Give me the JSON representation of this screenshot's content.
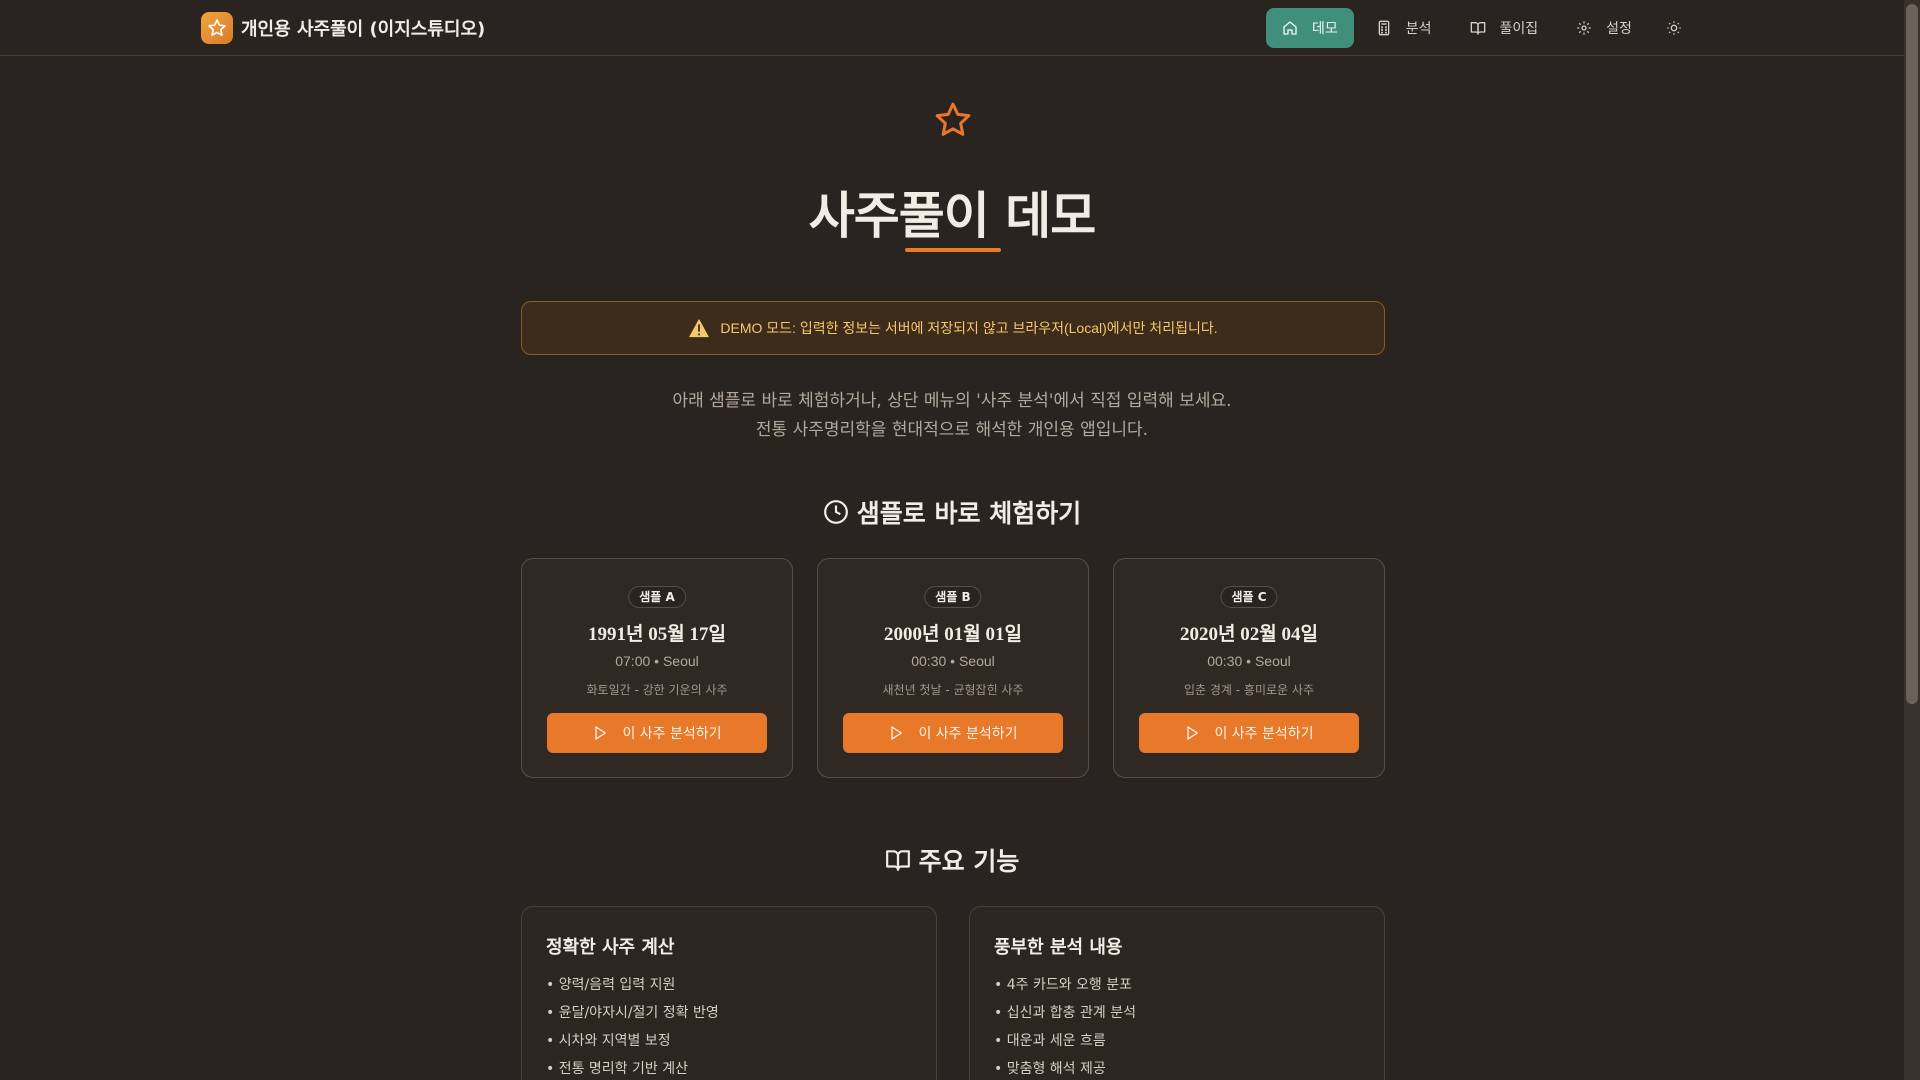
{
  "header": {
    "title": "개인용 사주풀이 (이지스튜디오)",
    "nav": [
      {
        "label": "데모",
        "icon": "home-icon",
        "active": true
      },
      {
        "label": "분석",
        "icon": "calculator-icon",
        "active": false
      },
      {
        "label": "풀이집",
        "icon": "book-icon",
        "active": false
      },
      {
        "label": "설정",
        "icon": "gear-icon",
        "active": false
      }
    ],
    "theme_icon": "sun-icon"
  },
  "hero": {
    "title": "사주풀이 데모",
    "banner": "DEMO 모드: 입력한 정보는 서버에 저장되지 않고 브라우저(Local)에서만 처리됩니다.",
    "intro_line1": "아래 샘플로 바로 체험하거나, 상단 메뉴의 '사주 분석'에서 직접 입력해 보세요.",
    "intro_line2": "전통 사주명리학을 현대적으로 해석한 개인용 앱입니다."
  },
  "samples": {
    "title": "샘플로 바로 체험하기",
    "cards": [
      {
        "badge": "샘플 A",
        "date": "1991년 05월 17일",
        "time": "07:00 • Seoul",
        "desc": "화토일간 - 강한 기운의 사주",
        "button": "이 사주 분석하기"
      },
      {
        "badge": "샘플 B",
        "date": "2000년 01월 01일",
        "time": "00:30 • Seoul",
        "desc": "새천년 첫날 - 균형잡힌 사주",
        "button": "이 사주 분석하기"
      },
      {
        "badge": "샘플 C",
        "date": "2020년 02월 04일",
        "time": "00:30 • Seoul",
        "desc": "입춘 경계 - 흥미로운 사주",
        "button": "이 사주 분석하기"
      }
    ]
  },
  "features": {
    "title": "주요 기능",
    "cards": [
      {
        "title": "정확한 사주 계산",
        "items": [
          "• 양력/음력 입력 지원",
          "• 윤달/야자시/절기 정확 반영",
          "• 시차와 지역별 보정",
          "• 전통 명리학 기반 계산"
        ]
      },
      {
        "title": "풍부한 분석 내용",
        "items": [
          "• 4주 카드와 오행 분포",
          "• 십신과 합충 관계 분석",
          "• 대운과 세운 흐름",
          "• 맞춤형 해석 제공"
        ]
      }
    ]
  },
  "colors": {
    "accent": "#e8782a",
    "nav_active": "#3f8f7b",
    "background": "#2a2420",
    "warning": "#f4c96a"
  }
}
